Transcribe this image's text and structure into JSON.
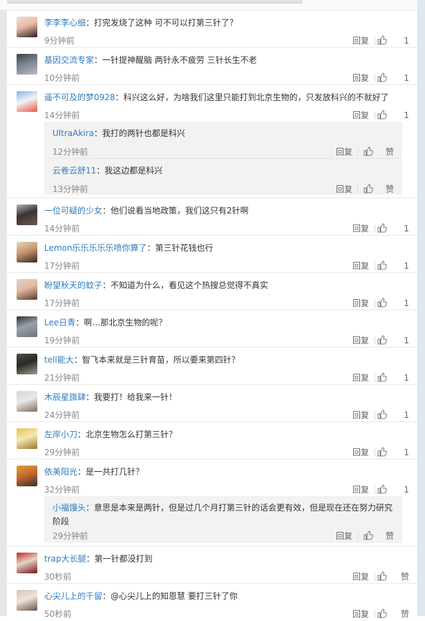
{
  "actions": {
    "reply_label": "回复",
    "like_icon": "thumb-up-icon"
  },
  "comments": [
    {
      "user": "李李李心细",
      "text": "打完发烧了这种 可不可以打第三针了？",
      "time": "9分钟前",
      "likes": "1",
      "avatar_colors": [
        "#ece3d8",
        "#2a2022",
        "#e9b9a2"
      ]
    },
    {
      "user": "基因交流专家",
      "text": "一针提神醒脑 两针永不疲劳 三针长生不老",
      "time": "10分钟前",
      "likes": "1",
      "avatar_colors": [
        "#3c3f46",
        "#b8bdc6",
        "#7b828e"
      ]
    },
    {
      "user": "遥不可及的梦0928",
      "text": "科兴这么好，为啥我们这里只能打到北京生物的，只发放科兴的不就好了",
      "time": "14分钟前",
      "likes": "1",
      "avatar_colors": [
        "#7fb3e6",
        "#e8564b",
        "#f4f4f4"
      ],
      "replies": [
        {
          "user": "UltraAkira",
          "text": "我打的两针也都是科兴",
          "time": "12分钟前",
          "likes": "赞"
        },
        {
          "user": "云卷云舒11",
          "text": "我这边都是科兴",
          "time": "13分钟前",
          "likes": "赞"
        }
      ]
    },
    {
      "user": "一位可疑的少女",
      "text": "他们说看当地政策，我们这只有2针啊",
      "time": "14分钟前",
      "likes": "1",
      "avatar_colors": [
        "#b5b7b4",
        "#6d5a4c",
        "#3b3432"
      ]
    },
    {
      "user": "Lemon乐乐乐乐乐喷你算了",
      "text": "第三针花钱也行",
      "time": "17分钟前",
      "likes": "1",
      "avatar_colors": [
        "#e4d7c6",
        "#3b2a24",
        "#c9976f"
      ]
    },
    {
      "user": "盼望秋天的蚊子",
      "text": "不知道为什么，看见这个热搜总觉得不真实",
      "time": "17分钟前",
      "likes": "1",
      "avatar_colors": [
        "#d8d3cc",
        "#5c3a2c",
        "#e2b9a0"
      ]
    },
    {
      "user": "Lee日青",
      "text": "啊…那北京生物的呢？",
      "time": "19分钟前",
      "likes": "1",
      "avatar_colors": [
        "#2c3038",
        "#6b7380",
        "#9aa1a9"
      ]
    },
    {
      "user": "tell能大",
      "text": "智飞本来就是三针育苗，所以要来第四针？",
      "time": "21分钟前",
      "likes": "1",
      "avatar_colors": [
        "#4f524e",
        "#9a9c8f",
        "#262824"
      ]
    },
    {
      "user": "木辰星旗肆",
      "text": "我要打！给我来一针！",
      "time": "24分钟前",
      "likes": "1",
      "avatar_colors": [
        "#cfd4d8",
        "#7f6b5b",
        "#e8e8e8"
      ]
    },
    {
      "user": "左岸小刀",
      "text": "北京生物怎么打第三针？",
      "time": "29分钟前",
      "likes": "1",
      "avatar_colors": [
        "#e9c24a",
        "#9b7a2a",
        "#f4e8b4"
      ]
    },
    {
      "user": "依美阳光",
      "text": "是一共打几针？",
      "time": "32分钟前",
      "likes": "1",
      "avatar_colors": [
        "#e29f3a",
        "#3f2e29",
        "#c66a2c"
      ],
      "replies": [
        {
          "user": "小福馒头",
          "text": "意思是本来是两针，但是过几个月打第三针的话会更有效，但是现在还在努力研究阶段",
          "time": "29分钟前",
          "likes": "赞"
        }
      ]
    },
    {
      "user": "trap大长腿",
      "text": "第一针都没打到",
      "time": "30秒前",
      "likes": "赞",
      "avatar_colors": [
        "#c4262a",
        "#7a1216",
        "#e4d3c6"
      ]
    },
    {
      "user": "心尖儿上的千留",
      "text": "@心尖儿上的知恩慧 要打三针了你",
      "time": "50秒前",
      "likes": "赞",
      "avatar_colors": [
        "#d7c3b4",
        "#6d5444",
        "#efe3d8"
      ]
    }
  ]
}
